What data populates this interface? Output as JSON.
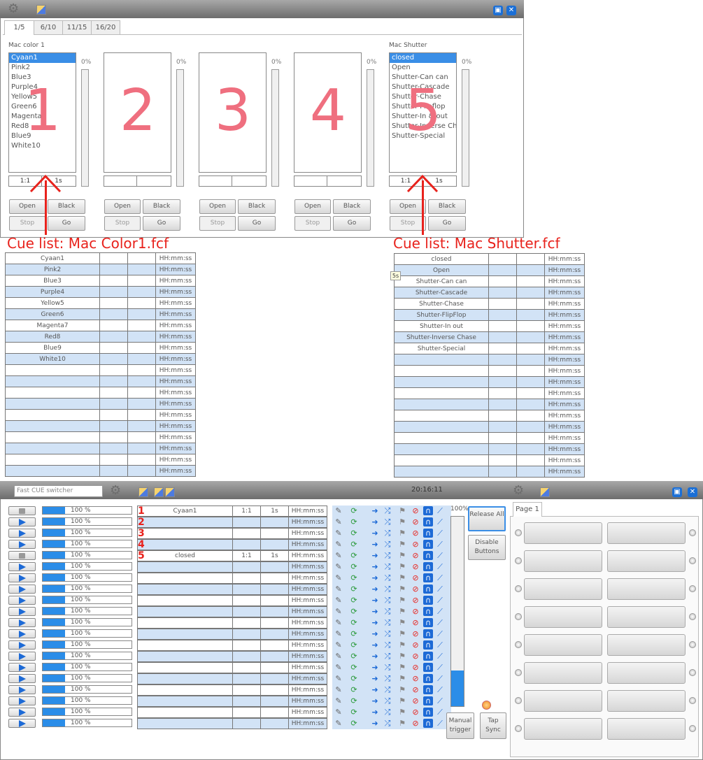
{
  "window1": {
    "tabs": [
      "1/5",
      "6/10",
      "11/15",
      "16/20"
    ],
    "fixtures": [
      {
        "title": "Mac color 1",
        "percent": "0%",
        "number": "1",
        "items": [
          "Cyaan1",
          "Pink2",
          "Blue3",
          "Purple4",
          "Yellow5",
          "Green6",
          "Magenta7",
          "Red8",
          "Blue9",
          "White10"
        ],
        "selected": 0,
        "display": [
          "1:1",
          "1s"
        ]
      },
      {
        "title": "",
        "percent": "0%",
        "number": "2",
        "items": [],
        "display": [
          "",
          ""
        ]
      },
      {
        "title": "",
        "percent": "0%",
        "number": "3",
        "items": [],
        "display": [
          "",
          ""
        ]
      },
      {
        "title": "",
        "percent": "0%",
        "number": "4",
        "items": [],
        "display": [
          "",
          ""
        ]
      },
      {
        "title": "Mac Shutter",
        "percent": "0%",
        "number": "5",
        "items": [
          "closed",
          "Open",
          "Shutter-Can can",
          "Shutter-Cascade",
          "Shutter-Chase",
          "Shutter-Flipflop",
          "Shutter-In & out",
          "Shutter-Inverse Ch",
          "Shutter-Special"
        ],
        "selected": 0,
        "display": [
          "1:1",
          "1s"
        ]
      }
    ],
    "buttons": {
      "open": "Open",
      "black": "Black",
      "stop": "Stop",
      "go": "Go"
    }
  },
  "annotations": {
    "left": "Cue list: Mac Color1.fcf",
    "right": "Cue list: Mac Shutter.fcf"
  },
  "cuelist_left": {
    "rows": [
      "Cyaan1",
      "Pink2",
      "Blue3",
      "Purple4",
      "Yellow5",
      "Green6",
      "Magenta7",
      "Red8",
      "Blue9",
      "White10",
      "",
      "",
      "",
      "",
      "",
      "",
      "",
      "",
      "",
      ""
    ],
    "time": "HH:mm:ss"
  },
  "cuelist_right": {
    "rows": [
      "closed",
      "Open",
      "Shutter-Can can",
      "Shutter-Cascade",
      "Shutter-Chase",
      "Shutter-FlipFlop",
      "Shutter-In out",
      "Shutter-Inverse Chase",
      "Shutter-Special",
      "",
      "",
      "",
      "",
      "",
      "",
      "",
      "",
      "",
      "",
      ""
    ],
    "time": "HH:mm:ss",
    "tooltip": "5s"
  },
  "window2": {
    "search_placeholder": "Fast CUE switcher",
    "clock": "20:16:11",
    "master_percent": "100%",
    "master_level": 0.19,
    "release_all": "Release All",
    "disable_buttons": "Disable Buttons",
    "manual_trigger": "Manual trigger",
    "tap_sync": "Tap Sync",
    "page_tab": "Page 1",
    "row_percent": "100 %",
    "cue_rows": [
      {
        "num": "1",
        "name": "Cyaan1",
        "ratio": "1:1",
        "time": "1s",
        "clock": "HH:mm:ss",
        "stopped": true
      },
      {
        "num": "2",
        "name": "",
        "ratio": "",
        "time": "",
        "clock": "HH:mm:ss",
        "stopped": false
      },
      {
        "num": "3",
        "name": "",
        "ratio": "",
        "time": "",
        "clock": "HH:mm:ss",
        "stopped": false
      },
      {
        "num": "4",
        "name": "",
        "ratio": "",
        "time": "",
        "clock": "HH:mm:ss",
        "stopped": false
      },
      {
        "num": "5",
        "name": "closed",
        "ratio": "1:1",
        "time": "1s",
        "clock": "HH:mm:ss",
        "stopped": true
      },
      {
        "num": "",
        "name": "",
        "ratio": "",
        "time": "",
        "clock": "HH:mm:ss",
        "stopped": false
      },
      {
        "num": "",
        "name": "",
        "ratio": "",
        "time": "",
        "clock": "HH:mm:ss",
        "stopped": false
      },
      {
        "num": "",
        "name": "",
        "ratio": "",
        "time": "",
        "clock": "HH:mm:ss",
        "stopped": false
      },
      {
        "num": "",
        "name": "",
        "ratio": "",
        "time": "",
        "clock": "HH:mm:ss",
        "stopped": false
      },
      {
        "num": "",
        "name": "",
        "ratio": "",
        "time": "",
        "clock": "HH:mm:ss",
        "stopped": false
      },
      {
        "num": "",
        "name": "",
        "ratio": "",
        "time": "",
        "clock": "HH:mm:ss",
        "stopped": false
      },
      {
        "num": "",
        "name": "",
        "ratio": "",
        "time": "",
        "clock": "HH:mm:ss",
        "stopped": false
      },
      {
        "num": "",
        "name": "",
        "ratio": "",
        "time": "",
        "clock": "HH:mm:ss",
        "stopped": false
      },
      {
        "num": "",
        "name": "",
        "ratio": "",
        "time": "",
        "clock": "HH:mm:ss",
        "stopped": false
      },
      {
        "num": "",
        "name": "",
        "ratio": "",
        "time": "",
        "clock": "HH:mm:ss",
        "stopped": false
      },
      {
        "num": "",
        "name": "",
        "ratio": "",
        "time": "",
        "clock": "HH:mm:ss",
        "stopped": false
      },
      {
        "num": "",
        "name": "",
        "ratio": "",
        "time": "",
        "clock": "HH:mm:ss",
        "stopped": false
      },
      {
        "num": "",
        "name": "",
        "ratio": "",
        "time": "",
        "clock": "HH:mm:ss",
        "stopped": false
      },
      {
        "num": "",
        "name": "",
        "ratio": "",
        "time": "",
        "clock": "HH:mm:ss",
        "stopped": false
      },
      {
        "num": "",
        "name": "",
        "ratio": "",
        "time": "",
        "clock": "HH:mm:ss",
        "stopped": false
      }
    ],
    "row_progress": 0.25
  },
  "colors": {
    "accent": "#1d6ad6",
    "annotation": "#e8221c",
    "row_alt": "#d2e3f6",
    "big_number": "#ef6f7f"
  }
}
